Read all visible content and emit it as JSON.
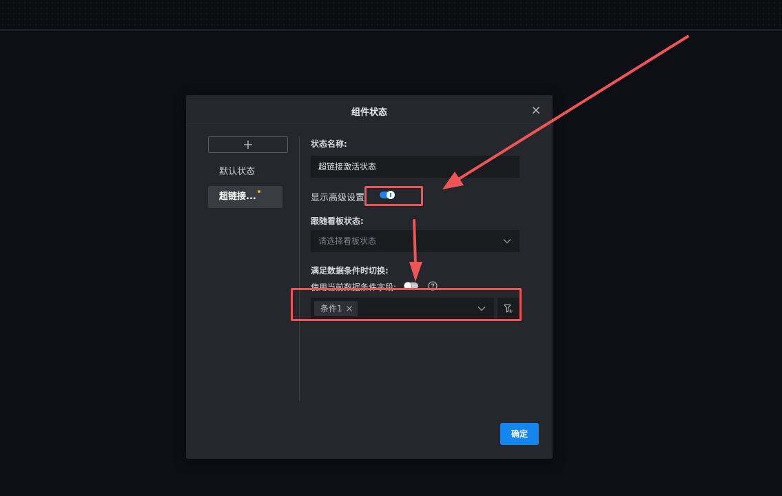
{
  "dialog": {
    "title": "组件状态",
    "close_icon": "close-icon",
    "confirm_label": "确定"
  },
  "sidebar": {
    "add_icon": "plus-icon",
    "items": [
      {
        "label": "默认状态",
        "active": false
      },
      {
        "label": "超链接...",
        "active": true,
        "has_dot": true
      }
    ]
  },
  "form": {
    "state_name_label": "状态名称:",
    "state_name_value": "超链接激活状态",
    "advanced_label": "显示高级设置:",
    "advanced_enabled": true,
    "follow_label": "跟随看板状态:",
    "follow_placeholder": "请选择看板状态",
    "condition_section_label": "满足数据条件时切换:",
    "use_current_field_label": "使用当前数据条件字段:",
    "use_current_field_enabled": false,
    "conditions": [
      "条件1"
    ],
    "filter_icon": "filter-add-icon"
  },
  "annotation": {
    "color": "#ee5656"
  },
  "colors": {
    "accent": "#1586f0",
    "dialog_bg": "#25272d",
    "page_bg": "#0d0f15"
  }
}
